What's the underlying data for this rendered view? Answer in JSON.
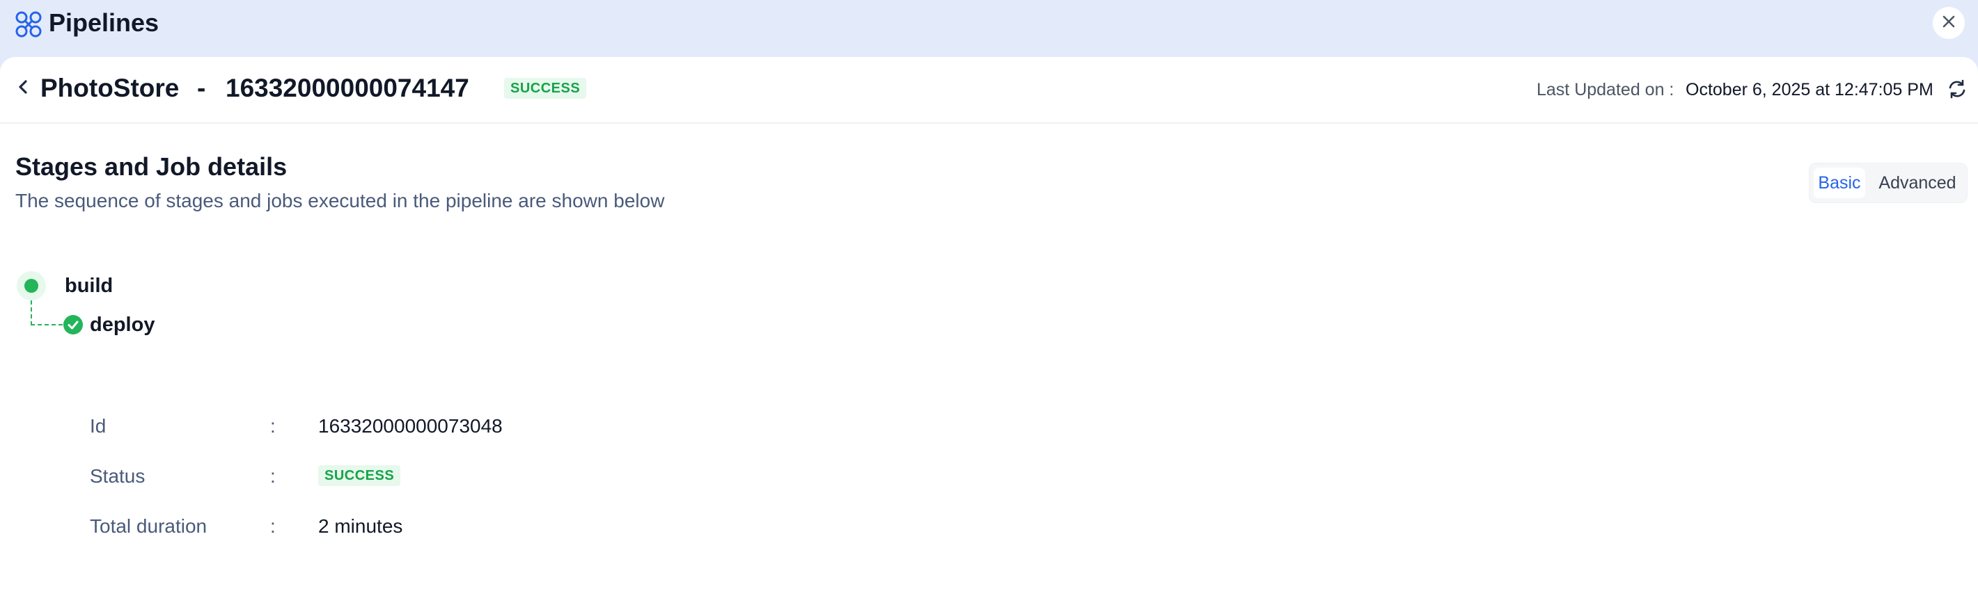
{
  "app": {
    "title": "Pipelines",
    "icon": "pipelines-icon"
  },
  "header": {
    "project": "PhotoStore",
    "separator": "-",
    "run_id": "16332000000074147",
    "status": "SUCCESS",
    "last_updated_label": "Last Updated on :",
    "last_updated_value": "October 6, 2025 at 12:47:05 PM"
  },
  "section": {
    "title": "Stages and Job details",
    "subtitle": "The sequence of stages and jobs executed in the pipeline are shown below"
  },
  "view_toggle": {
    "basic": "Basic",
    "advanced": "Advanced",
    "selected": "Basic"
  },
  "stages": [
    {
      "name": "build",
      "jobs": [
        {
          "name": "deploy",
          "details": {
            "id_label": "Id",
            "id_value": "16332000000073048",
            "status_label": "Status",
            "status_value": "SUCCESS",
            "duration_label": "Total duration",
            "duration_value": "2 minutes",
            "colon": ":"
          }
        }
      ]
    }
  ],
  "colors": {
    "accent": "#2563eb",
    "success": "#22b55a",
    "top_bar": "#e3ebfb"
  }
}
